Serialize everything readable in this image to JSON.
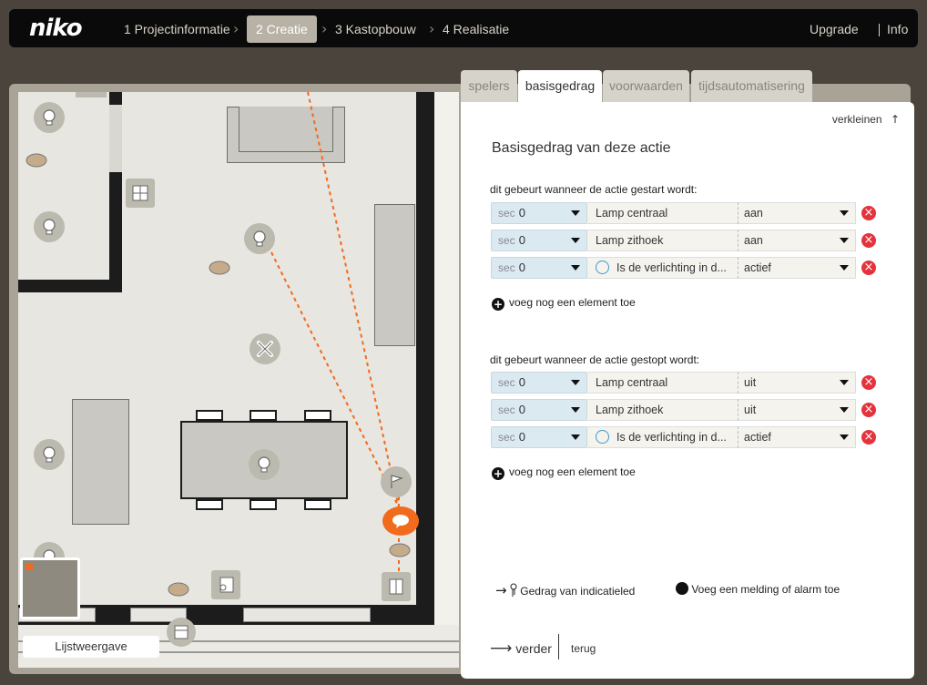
{
  "app": {
    "logo": "niko"
  },
  "steps": [
    {
      "label": "1 Projectinformatie",
      "active": false
    },
    {
      "label": "2 Creatie",
      "active": true
    },
    {
      "label": "3 Kastopbouw",
      "active": false
    },
    {
      "label": "4 Realisatie",
      "active": false
    }
  ],
  "top_right": {
    "upgrade": "Upgrade",
    "info": "Info"
  },
  "map": {
    "list_view_button": "Lijstweergave"
  },
  "tabs": [
    {
      "label": "spelers",
      "active": false
    },
    {
      "label": "basisgedrag",
      "active": true
    },
    {
      "label": "voorwaarden",
      "active": false
    },
    {
      "label": "tijdsautomatisering",
      "active": false
    }
  ],
  "panel": {
    "shrink": "verkleinen",
    "title": "Basisgedrag van deze actie",
    "start_section": {
      "label": "dit gebeurt wanneer de actie gestart wordt:",
      "rows": [
        {
          "sec_label": "sec",
          "sec_value": "0",
          "element": "Lamp centraal",
          "value": "aan",
          "has_sensor_icon": false
        },
        {
          "sec_label": "sec",
          "sec_value": "0",
          "element": "Lamp zithoek",
          "value": "aan",
          "has_sensor_icon": false
        },
        {
          "sec_label": "sec",
          "sec_value": "0",
          "element": "Is de verlichting in d...",
          "value": "actief",
          "has_sensor_icon": true
        }
      ],
      "add_label": "voeg nog een element toe"
    },
    "stop_section": {
      "label": "dit gebeurt wanneer de actie gestopt wordt:",
      "rows": [
        {
          "sec_label": "sec",
          "sec_value": "0",
          "element": "Lamp centraal",
          "value": "uit",
          "has_sensor_icon": false
        },
        {
          "sec_label": "sec",
          "sec_value": "0",
          "element": "Lamp zithoek",
          "value": "uit",
          "has_sensor_icon": false
        },
        {
          "sec_label": "sec",
          "sec_value": "0",
          "element": "Is de verlichting in d...",
          "value": "actief",
          "has_sensor_icon": true
        }
      ],
      "add_label": "voeg nog een element toe"
    },
    "indicator_link": "Gedrag van indicatieled",
    "alarm_link": "Voeg een melding of alarm toe",
    "next": "verder",
    "back": "terug"
  },
  "colors": {
    "accent": "#f26a1b",
    "delete": "#e5323b",
    "sec_field": "#dbe9f1"
  }
}
